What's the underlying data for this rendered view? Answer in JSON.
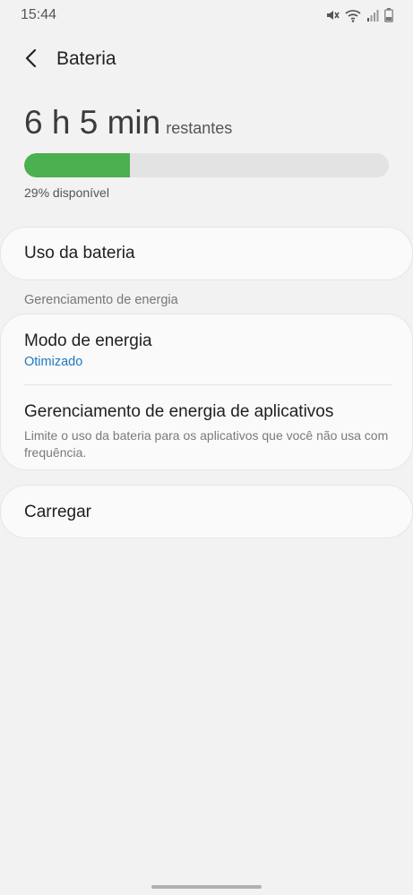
{
  "status_bar": {
    "time": "15:44",
    "icons": [
      "mute-icon",
      "wifi-icon",
      "signal-icon",
      "battery-icon"
    ]
  },
  "header": {
    "title": "Bateria",
    "back_icon": "back-arrow-icon"
  },
  "battery": {
    "time_value": "6 h 5 min",
    "time_suffix": "restantes",
    "level_percent": 29,
    "available_text": "29% disponível",
    "fill_color": "#4caf50"
  },
  "items": {
    "usage": {
      "title": "Uso da bateria"
    },
    "section_title": "Gerenciamento de energia",
    "power_mode": {
      "title": "Modo de energia",
      "value": "Otimizado"
    },
    "app_power": {
      "title": "Gerenciamento de energia de aplicativos",
      "description": "Limite o uso da bateria para os aplicativos que você não usa com frequência."
    },
    "charging": {
      "title": "Carregar"
    }
  },
  "colors": {
    "accent": "#1e78c2",
    "background": "#f2f2f2"
  }
}
